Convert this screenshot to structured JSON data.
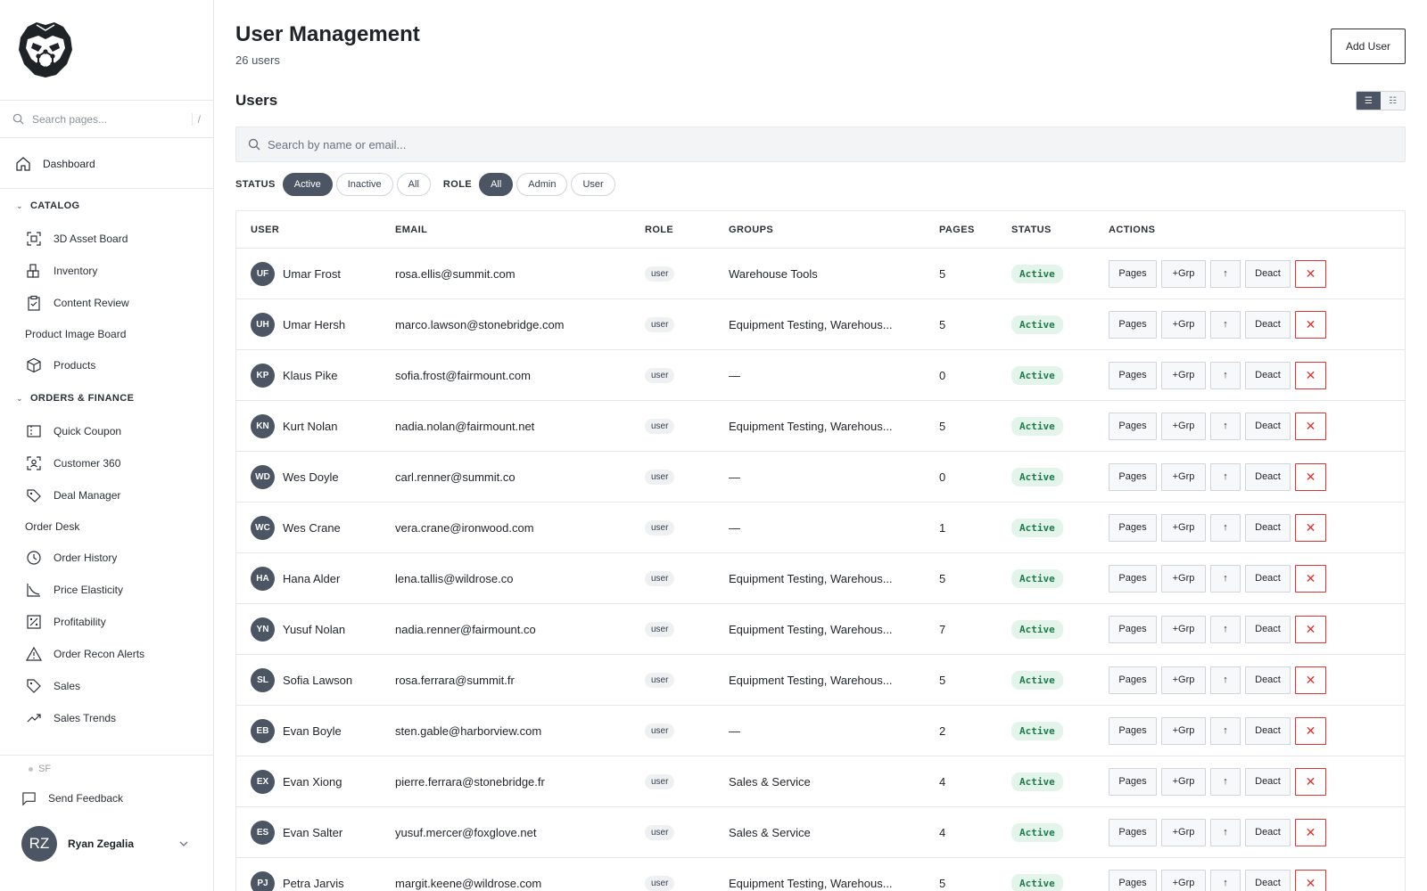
{
  "sidebar": {
    "search_placeholder": "Search pages...",
    "search_shortcut": "/",
    "dashboard_label": "Dashboard",
    "sections": [
      {
        "title": "CATALOG",
        "items": [
          {
            "label": "3D Asset Board",
            "icon": "scan-icon"
          },
          {
            "label": "Inventory",
            "icon": "boxes-icon"
          },
          {
            "label": "Content Review",
            "icon": "clipboard-check-icon"
          },
          {
            "label": "Product Image Board",
            "icon": ""
          },
          {
            "label": "Products",
            "icon": "package-icon"
          }
        ]
      },
      {
        "title": "ORDERS & FINANCE",
        "items": [
          {
            "label": "Quick Coupon",
            "icon": "coupon-icon"
          },
          {
            "label": "Customer 360",
            "icon": "user-scan-icon"
          },
          {
            "label": "Deal Manager",
            "icon": "tags-icon"
          },
          {
            "label": "Order Desk",
            "icon": ""
          },
          {
            "label": "Order History",
            "icon": "clock-icon"
          },
          {
            "label": "Price Elasticity",
            "icon": "curve-chart-icon"
          },
          {
            "label": "Profitability",
            "icon": "percent-icon"
          },
          {
            "label": "Order Recon Alerts",
            "icon": "warning-triangle-icon"
          },
          {
            "label": "Sales",
            "icon": "tag-icon"
          },
          {
            "label": "Sales Trends",
            "icon": "trending-up-icon"
          }
        ]
      }
    ],
    "env_label": "SF",
    "feedback_label": "Send Feedback",
    "user": {
      "initials": "RZ",
      "name": "Ryan Zegalia"
    }
  },
  "header": {
    "title": "User Management",
    "subtitle": "26 users",
    "add_button": "Add User"
  },
  "users_section": {
    "title": "Users",
    "search_placeholder": "Search by name or email..."
  },
  "filters": {
    "status_label": "STATUS",
    "status_options": [
      "Active",
      "Inactive",
      "All"
    ],
    "status_selected": "Active",
    "role_label": "ROLE",
    "role_options": [
      "All",
      "Admin",
      "User"
    ],
    "role_selected": "All"
  },
  "table": {
    "columns": [
      "USER",
      "EMAIL",
      "ROLE",
      "GROUPS",
      "PAGES",
      "STATUS",
      "ACTIONS"
    ],
    "action_labels": {
      "pages": "Pages",
      "group": "+Grp",
      "promote": "↑",
      "deactivate": "Deact",
      "delete": "✕"
    },
    "rows": [
      {
        "initials": "UF",
        "name": "Umar Frost",
        "email": "rosa.ellis@summit.com",
        "role": "user",
        "groups": "Warehouse Tools",
        "pages": "5",
        "status": "Active"
      },
      {
        "initials": "UH",
        "name": "Umar Hersh",
        "email": "marco.lawson@stonebridge.com",
        "role": "user",
        "groups": "Equipment Testing, Warehous...",
        "pages": "5",
        "status": "Active"
      },
      {
        "initials": "KP",
        "name": "Klaus Pike",
        "email": "sofia.frost@fairmount.com",
        "role": "user",
        "groups": "—",
        "pages": "0",
        "status": "Active"
      },
      {
        "initials": "KN",
        "name": "Kurt Nolan",
        "email": "nadia.nolan@fairmount.net",
        "role": "user",
        "groups": "Equipment Testing, Warehous...",
        "pages": "5",
        "status": "Active"
      },
      {
        "initials": "WD",
        "name": "Wes Doyle",
        "email": "carl.renner@summit.co",
        "role": "user",
        "groups": "—",
        "pages": "0",
        "status": "Active"
      },
      {
        "initials": "WC",
        "name": "Wes Crane",
        "email": "vera.crane@ironwood.com",
        "role": "user",
        "groups": "—",
        "pages": "1",
        "status": "Active"
      },
      {
        "initials": "HA",
        "name": "Hana Alder",
        "email": "lena.tallis@wildrose.co",
        "role": "user",
        "groups": "Equipment Testing, Warehous...",
        "pages": "5",
        "status": "Active"
      },
      {
        "initials": "YN",
        "name": "Yusuf Nolan",
        "email": "nadia.renner@fairmount.co",
        "role": "user",
        "groups": "Equipment Testing, Warehous...",
        "pages": "7",
        "status": "Active"
      },
      {
        "initials": "SL",
        "name": "Sofia Lawson",
        "email": "rosa.ferrara@summit.fr",
        "role": "user",
        "groups": "Equipment Testing, Warehous...",
        "pages": "5",
        "status": "Active"
      },
      {
        "initials": "EB",
        "name": "Evan Boyle",
        "email": "sten.gable@harborview.com",
        "role": "user",
        "groups": "—",
        "pages": "2",
        "status": "Active"
      },
      {
        "initials": "EX",
        "name": "Evan Xiong",
        "email": "pierre.ferrara@stonebridge.fr",
        "role": "user",
        "groups": "Sales & Service",
        "pages": "4",
        "status": "Active"
      },
      {
        "initials": "ES",
        "name": "Evan Salter",
        "email": "yusuf.mercer@foxglove.net",
        "role": "user",
        "groups": "Sales & Service",
        "pages": "4",
        "status": "Active"
      },
      {
        "initials": "PJ",
        "name": "Petra Jarvis",
        "email": "margit.keene@wildrose.com",
        "role": "user",
        "groups": "Equipment Testing, Warehous...",
        "pages": "5",
        "status": "Active"
      }
    ]
  }
}
